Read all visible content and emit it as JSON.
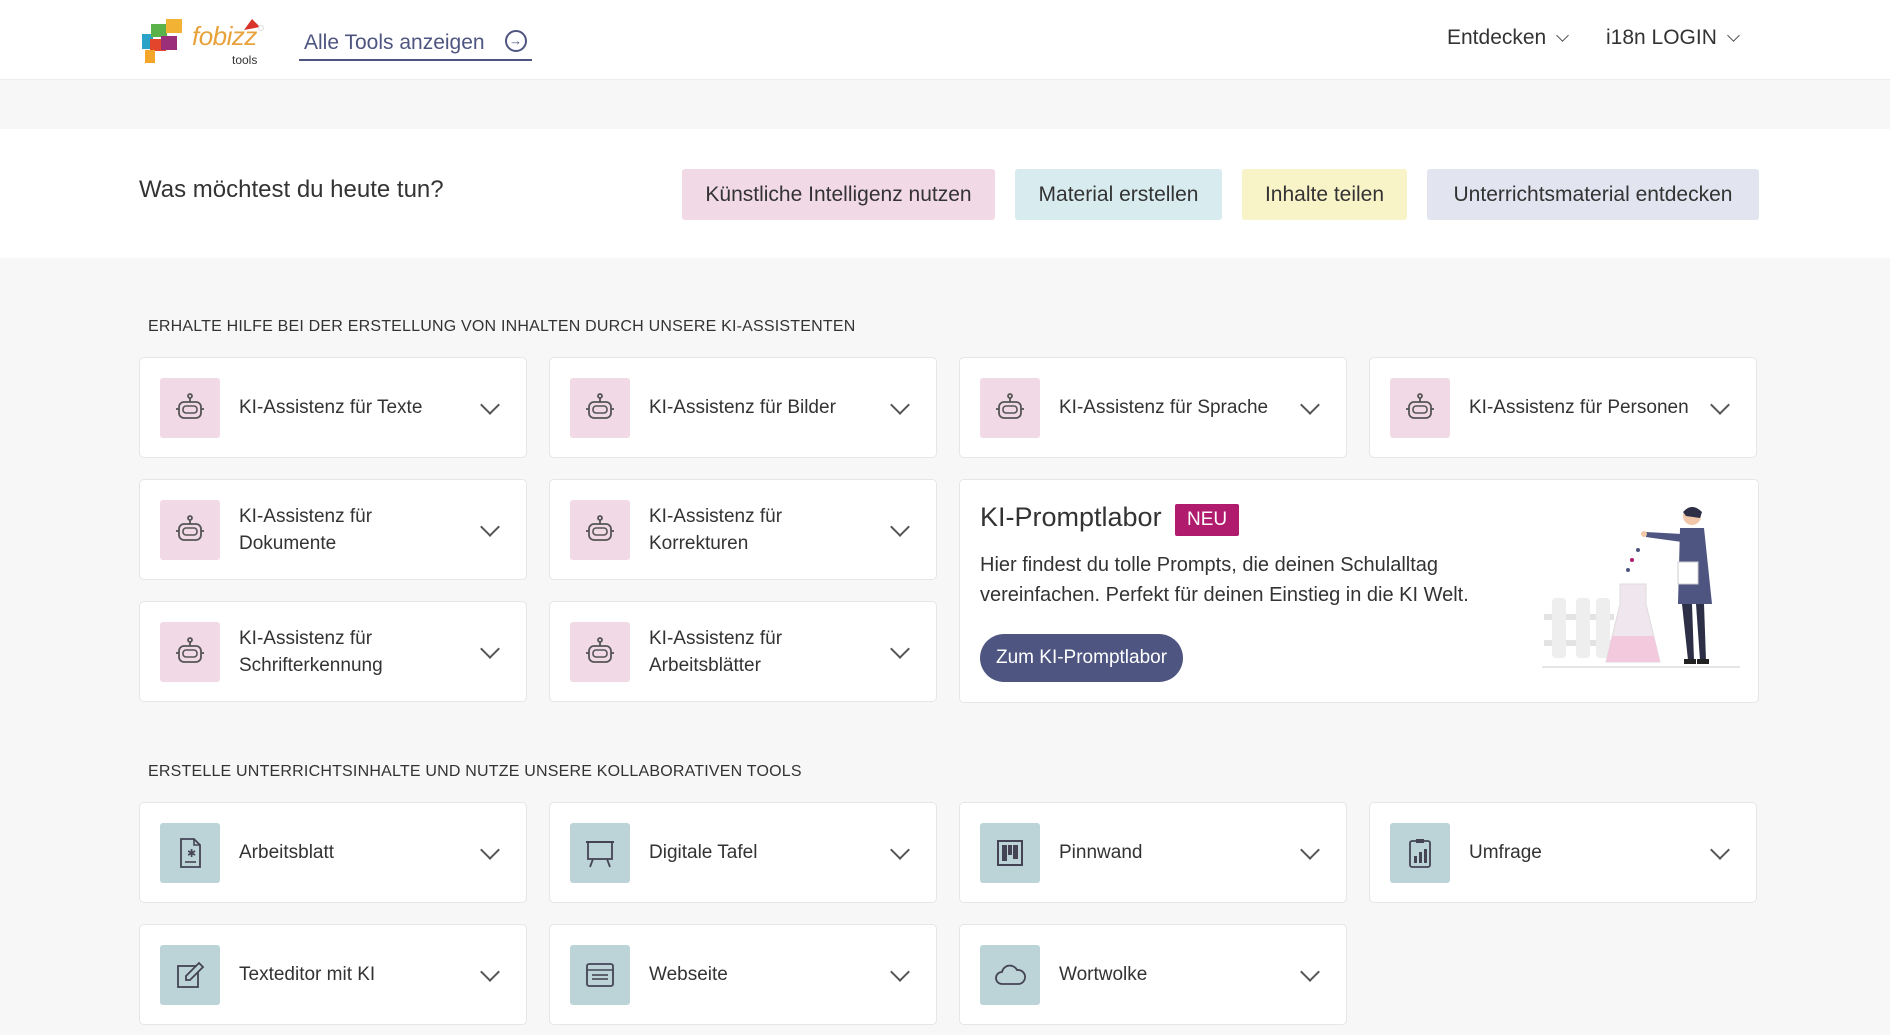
{
  "header": {
    "logo_text": "fobizz",
    "logo_sub": "tools",
    "all_tools": "Alle Tools anzeigen",
    "discover": "Entdecken",
    "login": "i18n LOGIN"
  },
  "question": {
    "title": "Was möchtest du heute tun?",
    "buttons": [
      {
        "label": "Künstliche Intelligenz nutzen",
        "color": "#f2d9e6"
      },
      {
        "label": "Material erstellen",
        "color": "#d8ecef"
      },
      {
        "label": "Inhalte teilen",
        "color": "#f9f3c8"
      },
      {
        "label": "Unterrichtsmaterial entdecken",
        "color": "#e2e4ef"
      }
    ]
  },
  "ki_section": {
    "heading": "ERHALTE HILFE BEI DER ERSTELLUNG VON INHALTEN DURCH UNSERE KI-ASSISTENTEN",
    "cards": [
      {
        "label": "KI-Assistenz für Texte",
        "icon": "robot-icon"
      },
      {
        "label": "KI-Assistenz für Bilder",
        "icon": "robot-icon"
      },
      {
        "label": "KI-Assistenz für Sprache",
        "icon": "robot-icon"
      },
      {
        "label": "KI-Assistenz für Personen",
        "icon": "robot-icon"
      },
      {
        "label": "KI-Assistenz für Dokumente",
        "icon": "robot-icon"
      },
      {
        "label": "KI-Assistenz für Korrekturen",
        "icon": "robot-icon"
      },
      {
        "label": "KI-Assistenz für Schrifterkennung",
        "icon": "robot-icon"
      },
      {
        "label": "KI-Assistenz für Arbeitsblätter",
        "icon": "robot-icon"
      }
    ]
  },
  "promptlabor": {
    "title": "KI-Promptlabor",
    "badge": "NEU",
    "text": "Hier findest du tolle Prompts, die deinen Schulalltag vereinfachen. Perfekt für deinen Einstieg in die KI Welt.",
    "button": "Zum KI-Promptlabor"
  },
  "tools_section": {
    "heading": "ERSTELLE UNTERRICHTSINHALTE UND NUTZE UNSERE KOLLABORATIVEN TOOLS",
    "cards": [
      {
        "label": "Arbeitsblatt",
        "icon": "worksheet-icon"
      },
      {
        "label": "Digitale Tafel",
        "icon": "whiteboard-icon"
      },
      {
        "label": "Pinnwand",
        "icon": "pinboard-icon"
      },
      {
        "label": "Umfrage",
        "icon": "survey-icon"
      },
      {
        "label": "Texteditor mit KI",
        "icon": "edit-icon"
      },
      {
        "label": "Webseite",
        "icon": "website-icon"
      },
      {
        "label": "Wortwolke",
        "icon": "cloud-icon"
      }
    ]
  },
  "colors": {
    "accent": "#4e5580",
    "badge": "#b01b6e",
    "ki_icon_bg": "#f2d9e6",
    "tool_icon_bg": "#bcd3d8"
  }
}
